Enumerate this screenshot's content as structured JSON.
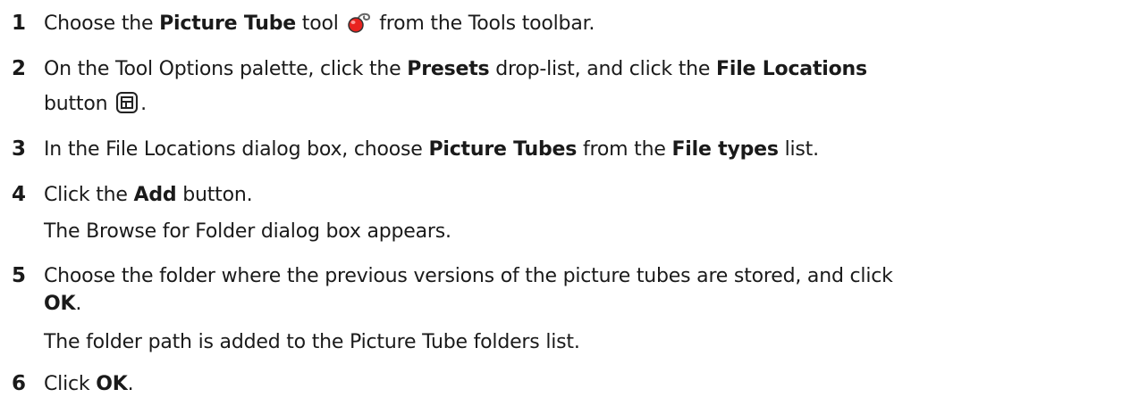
{
  "steps": [
    {
      "number": "1",
      "parts": {
        "a": "Choose the ",
        "b": "Picture Tube",
        "c": " tool ",
        "d": " from the Tools toolbar."
      }
    },
    {
      "number": "2",
      "parts": {
        "a": "On the Tool Options palette, click the ",
        "b": "Presets",
        "c": " drop-list, and click the ",
        "d": "File Locations",
        "e": "button ",
        "f": "."
      }
    },
    {
      "number": "3",
      "parts": {
        "a": "In the File Locations dialog box, choose ",
        "b": "Picture Tubes",
        "c": " from the ",
        "d": "File types",
        "e": " list."
      }
    },
    {
      "number": "4",
      "parts": {
        "a": "Click the ",
        "b": "Add",
        "c": " button."
      },
      "note": "The Browse for Folder dialog box appears."
    },
    {
      "number": "5",
      "parts": {
        "a": "Choose the folder where the previous versions of the picture tubes are stored, and click",
        "b": "OK",
        "c": "."
      },
      "note": "The folder path is added to the Picture Tube folders list."
    },
    {
      "number": "6",
      "parts": {
        "a": "Click ",
        "b": "OK",
        "c": "."
      }
    }
  ],
  "icons": {
    "picture_tube": "picture-tube-icon",
    "file_locations": "file-locations-icon"
  },
  "colors": {
    "text": "#1a1a1a",
    "tube_red": "#e8231f"
  }
}
